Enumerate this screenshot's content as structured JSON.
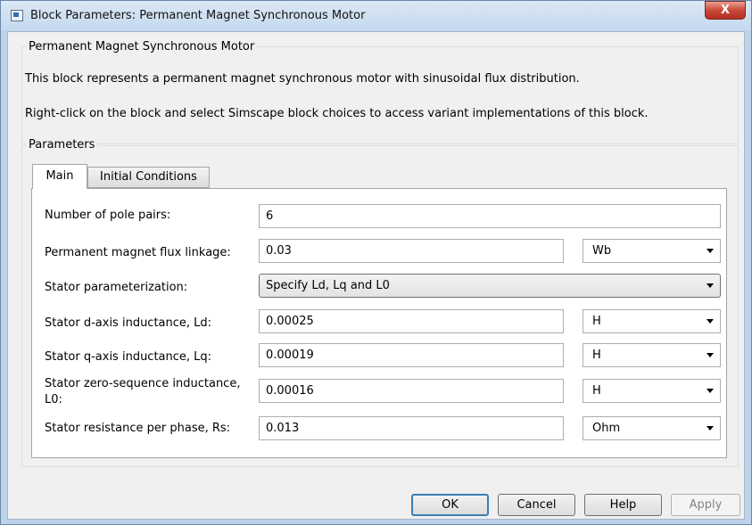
{
  "window": {
    "title": "Block Parameters: Permanent Magnet Synchronous Motor",
    "close_glyph": "X"
  },
  "description": {
    "group_title": "Permanent Magnet Synchronous Motor",
    "line1": "This block represents a permanent magnet synchronous motor with sinusoidal flux distribution.",
    "line2": "Right-click on the block and select Simscape block choices to access variant implementations of this block."
  },
  "parameters": {
    "group_title": "Parameters",
    "tabs": [
      {
        "label": "Main"
      },
      {
        "label": "Initial Conditions"
      }
    ],
    "rows": [
      {
        "label": "Number of pole pairs:",
        "value": "6"
      },
      {
        "label": "Permanent magnet flux linkage:",
        "value": "0.03",
        "unit": "Wb"
      },
      {
        "label": "Stator parameterization:",
        "value": "Specify Ld, Lq and L0"
      },
      {
        "label": "Stator d-axis inductance, Ld:",
        "value": "0.00025",
        "unit": "H"
      },
      {
        "label": "Stator q-axis inductance, Lq:",
        "value": "0.00019",
        "unit": "H"
      },
      {
        "label_line1": "Stator zero-sequence inductance,",
        "label_line2": "L0:",
        "value": "0.00016",
        "unit": "H"
      },
      {
        "label": "Stator resistance per phase, Rs:",
        "value": "0.013",
        "unit": "Ohm"
      }
    ]
  },
  "buttons": {
    "ok": "OK",
    "cancel": "Cancel",
    "help": "Help",
    "apply": "Apply"
  }
}
